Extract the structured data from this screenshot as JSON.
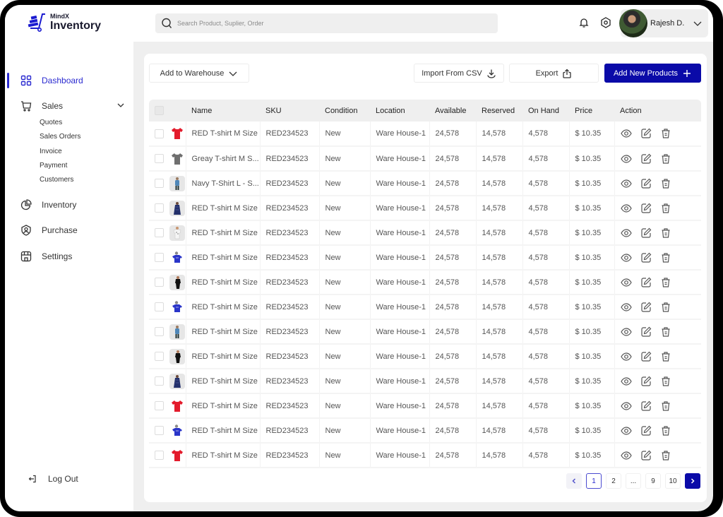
{
  "app": {
    "brand_small": "MindX",
    "brand_big": "Inventory",
    "accent_color": "#0a0aa8"
  },
  "sidebar": {
    "items": [
      {
        "label": "Dashboard",
        "icon": "grid-icon",
        "active": true
      },
      {
        "label": "Sales",
        "icon": "cart-icon",
        "expanded": true,
        "children": [
          "Quotes",
          "Sales Orders",
          "Invoice",
          "Payment",
          "Customers"
        ]
      },
      {
        "label": "Inventory",
        "icon": "pie-chart-icon"
      },
      {
        "label": "Purchase",
        "icon": "user-shield-icon"
      },
      {
        "label": "Settings",
        "icon": "store-icon"
      }
    ],
    "logout_label": "Log Out"
  },
  "topbar": {
    "search_placeholder": "Search Product, Suplier, Order",
    "search_value": "",
    "user_name": "Rajesh D."
  },
  "toolbar": {
    "warehouse_label": "Add to Warehouse",
    "import_label": "Import From CSV",
    "export_label": "Export",
    "add_label": "Add New Products"
  },
  "table": {
    "columns": [
      "Name",
      "SKU",
      "Condition",
      "Location",
      "Available",
      "Reserved",
      "On Hand",
      "Price",
      "Action"
    ],
    "rows": [
      {
        "thumb": "red-tshirt",
        "name": "RED T-shirt M Size",
        "sku": "RED234523",
        "condition": "New",
        "location": "Ware House-1",
        "available": "24,578",
        "reserved": "14,578",
        "on_hand": "4,578",
        "price": "$ 10.35"
      },
      {
        "thumb": "grey-tshirt",
        "name": "Greay T-shirt M S...",
        "sku": "RED234523",
        "condition": "New",
        "location": "Ware House-1",
        "available": "24,578",
        "reserved": "14,578",
        "on_hand": "4,578",
        "price": "$ 10.35"
      },
      {
        "thumb": "light-blue-model",
        "name": "Navy T-Shirt L - S...",
        "sku": "RED234523",
        "condition": "New",
        "location": "Ware House-1",
        "available": "24,578",
        "reserved": "14,578",
        "on_hand": "4,578",
        "price": "$ 10.35"
      },
      {
        "thumb": "navy-dress-model",
        "name": "RED T-shirt M Size",
        "sku": "RED234523",
        "condition": "New",
        "location": "Ware House-1",
        "available": "24,578",
        "reserved": "14,578",
        "on_hand": "4,578",
        "price": "$ 10.35"
      },
      {
        "thumb": "white-print-model",
        "name": "RED T-shirt M Size",
        "sku": "RED234523",
        "condition": "New",
        "location": "Ware House-1",
        "available": "24,578",
        "reserved": "14,578",
        "on_hand": "4,578",
        "price": "$ 10.35"
      },
      {
        "thumb": "blue-print-model",
        "name": "RED T-shirt M Size",
        "sku": "RED234523",
        "condition": "New",
        "location": "Ware House-1",
        "available": "24,578",
        "reserved": "14,578",
        "on_hand": "4,578",
        "price": "$ 10.35"
      },
      {
        "thumb": "black-model",
        "name": "RED T-shirt M Size",
        "sku": "RED234523",
        "condition": "New",
        "location": "Ware House-1",
        "available": "24,578",
        "reserved": "14,578",
        "on_hand": "4,578",
        "price": "$ 10.35"
      },
      {
        "thumb": "blue-print-model",
        "name": "RED T-shirt M Size",
        "sku": "RED234523",
        "condition": "New",
        "location": "Ware House-1",
        "available": "24,578",
        "reserved": "14,578",
        "on_hand": "4,578",
        "price": "$ 10.35"
      },
      {
        "thumb": "light-blue-model",
        "name": "RED T-shirt M Size",
        "sku": "RED234523",
        "condition": "New",
        "location": "Ware House-1",
        "available": "24,578",
        "reserved": "14,578",
        "on_hand": "4,578",
        "price": "$ 10.35"
      },
      {
        "thumb": "black-model",
        "name": "RED T-shirt M Size",
        "sku": "RED234523",
        "condition": "New",
        "location": "Ware House-1",
        "available": "24,578",
        "reserved": "14,578",
        "on_hand": "4,578",
        "price": "$ 10.35"
      },
      {
        "thumb": "navy-dress-model",
        "name": "RED T-shirt M Size",
        "sku": "RED234523",
        "condition": "New",
        "location": "Ware House-1",
        "available": "24,578",
        "reserved": "14,578",
        "on_hand": "4,578",
        "price": "$ 10.35"
      },
      {
        "thumb": "red-tshirt",
        "name": "RED T-shirt M Size",
        "sku": "RED234523",
        "condition": "New",
        "location": "Ware House-1",
        "available": "24,578",
        "reserved": "14,578",
        "on_hand": "4,578",
        "price": "$ 10.35"
      },
      {
        "thumb": "blue-print-model",
        "name": "RED T-shirt M Size",
        "sku": "RED234523",
        "condition": "New",
        "location": "Ware House-1",
        "available": "24,578",
        "reserved": "14,578",
        "on_hand": "4,578",
        "price": "$ 10.35"
      },
      {
        "thumb": "red-tshirt",
        "name": "RED T-shirt M Size",
        "sku": "RED234523",
        "condition": "New",
        "location": "Ware House-1",
        "available": "24,578",
        "reserved": "14,578",
        "on_hand": "4,578",
        "price": "$ 10.35"
      }
    ],
    "actions": [
      "view-icon",
      "edit-icon",
      "delete-icon"
    ]
  },
  "pagination": {
    "pages": [
      "1",
      "2",
      "...",
      "9",
      "10"
    ],
    "current": "1"
  }
}
